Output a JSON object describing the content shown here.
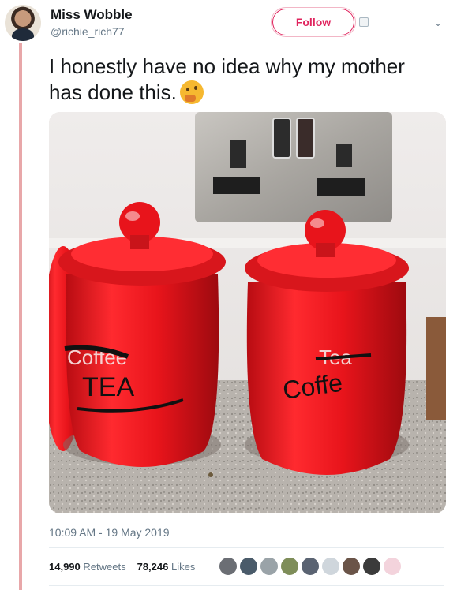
{
  "author": {
    "name": "Miss Wobble",
    "handle": "@richie_rich77"
  },
  "actions": {
    "follow_label": "Follow"
  },
  "tweet": {
    "text": "I honestly have no idea why my mother has done this.",
    "emoji": "thinking-face-emoji",
    "timestamp": "10:09 AM - 19 May 2019"
  },
  "photo": {
    "left_jar_text": "TEA",
    "left_jar_crossed_text": "Coffee",
    "right_jar_text": "Coffe",
    "right_jar_crossed_text": "Tea"
  },
  "stats": {
    "retweets_count": "14,990",
    "retweets_label": "Retweets",
    "likes_count": "78,246",
    "likes_label": "Likes"
  },
  "colors": {
    "accent": "#e0245e",
    "thread_line": "#e8a7a9",
    "jar_red": "#e8141b"
  }
}
